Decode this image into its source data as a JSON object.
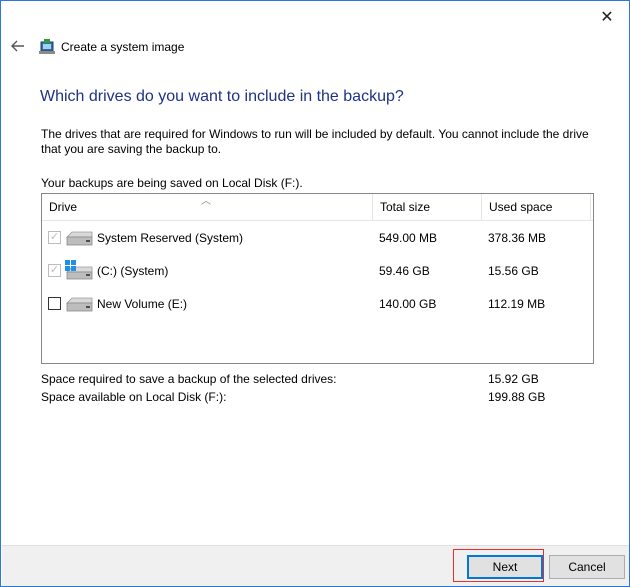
{
  "window": {
    "title": "Create a system image",
    "close_glyph": "✕",
    "back_glyph": "←"
  },
  "content": {
    "heading": "Which drives do you want to include in the backup?",
    "description": "The drives that are required for Windows to run will be included by default. You cannot include the drive that you are saving the backup to.",
    "saved_to": "Your backups are being saved on Local Disk (F:)."
  },
  "drive_list": {
    "columns": {
      "drive": "Drive",
      "total": "Total size",
      "used": "Used space"
    },
    "rows": [
      {
        "name": "System Reserved (System)",
        "total": "549.00 MB",
        "used": "378.36 MB",
        "checked": true,
        "disabled": true,
        "icon": "hdd-icon"
      },
      {
        "name": "(C:) (System)",
        "total": "59.46 GB",
        "used": "15.56 GB",
        "checked": true,
        "disabled": true,
        "icon": "windows-drive-icon"
      },
      {
        "name": "New Volume (E:)",
        "total": "140.00 GB",
        "used": "112.19 MB",
        "checked": false,
        "disabled": false,
        "icon": "hdd-icon"
      }
    ]
  },
  "summary": {
    "required_label": "Space required to save a backup of the selected drives:",
    "required_value": "15.92 GB",
    "available_label": "Space available on Local Disk (F:):",
    "available_value": "199.88 GB"
  },
  "buttons": {
    "next": "Next",
    "cancel": "Cancel"
  },
  "colors": {
    "heading": "#1e3287",
    "window_border": "#2b78d6",
    "highlight": "#e03030"
  }
}
